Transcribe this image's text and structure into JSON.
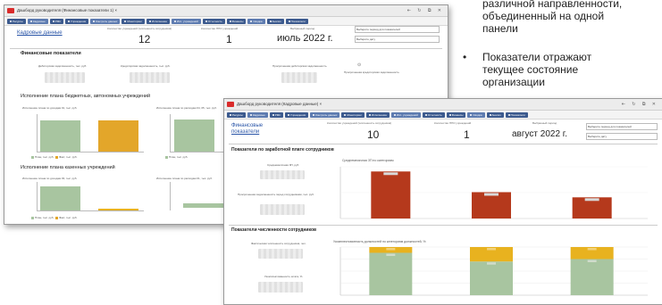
{
  "slide": {
    "line1": "различной направленности,",
    "line2": "объединенный на одной",
    "line3": "панели",
    "bullet": "•",
    "b2_line1": "Показатели отражают",
    "b2_line2": "текущее состояние",
    "b2_line3": "организации"
  },
  "back": {
    "title": "Дашборд руководителя (Финансовые показатели 1) ×",
    "toolbar": [
      "Ресурсы",
      "Кадровые",
      "РМК",
      "Учреждения",
      "Контроль данных",
      "Мониторинг",
      "Исполнение",
      "Исп. учреждений",
      "Отчетность",
      "Финансы",
      "Сводка",
      "Анализ",
      "Показатели"
    ],
    "kadr_link": "Кадровые данные",
    "kpi1_label": "Количество учреждений (численность сотрудников)",
    "kpi1_value": "12",
    "kpi2_label": "Количество ППО учреждений",
    "kpi2_value": "1",
    "kpi3_label": "Выбранный период",
    "kpi3_value": "июль 2022 г.",
    "box1": "Выберите период для показателей",
    "box2": "Выберите дату",
    "fin_title": "Финансовые показатели",
    "fin_sub1": "Дебиторская задолженность, тыс. руб.",
    "fin_sub2": "Кредиторская задолженность, тыс. руб.",
    "fin_sub3": "Просроченная дебиторская задолженность",
    "fin_sub4": "Просроченная кредиторская задолженность",
    "exec_title": "Исполнение плана бюджетных, автономных учреждений",
    "exec_sub1": "Исполнение плана по доходам 01, тыс. руб.",
    "exec_sub2": "Исполнение плана по расходам 04, 05, тыс. руб.",
    "kaz_title": "Исполнение плана казенных учреждений",
    "kaz_sub1": "Исполнение плана по доходам 03, тыс. руб.",
    "kaz_sub2": "Исполнение плана по расходам 01, тыс. руб.",
    "legend_plan": "План, тыс. руб.",
    "legend_fact": "Факт, тыс. руб."
  },
  "front": {
    "title": "Дашборд руководителя (Кадровые данные) ×",
    "toolbar": [
      "Ресурсы",
      "Кадровые",
      "РМК",
      "Учреждения",
      "Контроль данных",
      "Мониторинг",
      "Исполнение",
      "Исп. учреждений",
      "Отчетность",
      "Финансы",
      "Сводка",
      "Анализ",
      "Показатели"
    ],
    "fin_link_1": "Финансовые",
    "fin_link_2": "показатели",
    "kpi1_label": "Количество учреждений (численность сотрудников)",
    "kpi1_value": "10",
    "kpi2_label": "Количество ППО учреждений",
    "kpi2_value": "1",
    "kpi3_label": "Выбранный период",
    "kpi3_value": "август 2022 г.",
    "box1": "Выберите период для показателей",
    "box2": "Выберите дату",
    "salary_title": "Показатели по заработной плате сотрудников",
    "salary_sub1": "Среднемесячная ЗП, руб.",
    "salary_sub2": "Просроченная задолженность перед сотрудниками, тыс. руб.",
    "salary_chart_title": "Среднемесячная ЗП по категориям",
    "staff_title": "Показатели численности сотрудников",
    "staff_sub1": "Фактическая численность сотрудников, чел.",
    "staff_sub2": "Укомплектованность штата, %",
    "staff_chart_title": "Укомплектованность должностей по категориям должностей, %"
  },
  "chart_data": [
    {
      "type": "bar",
      "title": "Среднемесячная ЗП по категориям",
      "categories": [
        "1",
        "2",
        "3"
      ],
      "values": [
        100,
        56,
        45
      ],
      "ylim": [
        0,
        110
      ],
      "colors": [
        "#b5391c"
      ]
    },
    {
      "type": "bar",
      "title": "Укомплектованность должностей по категориям должностей, %",
      "categories": [
        "1",
        "2",
        "3"
      ],
      "series": [
        {
          "values": [
            88,
            70,
            75
          ],
          "color": "#a8c5a0"
        },
        {
          "values": [
            12,
            30,
            25
          ],
          "color": "#e8b21f"
        }
      ],
      "ylim": [
        0,
        100
      ]
    }
  ]
}
